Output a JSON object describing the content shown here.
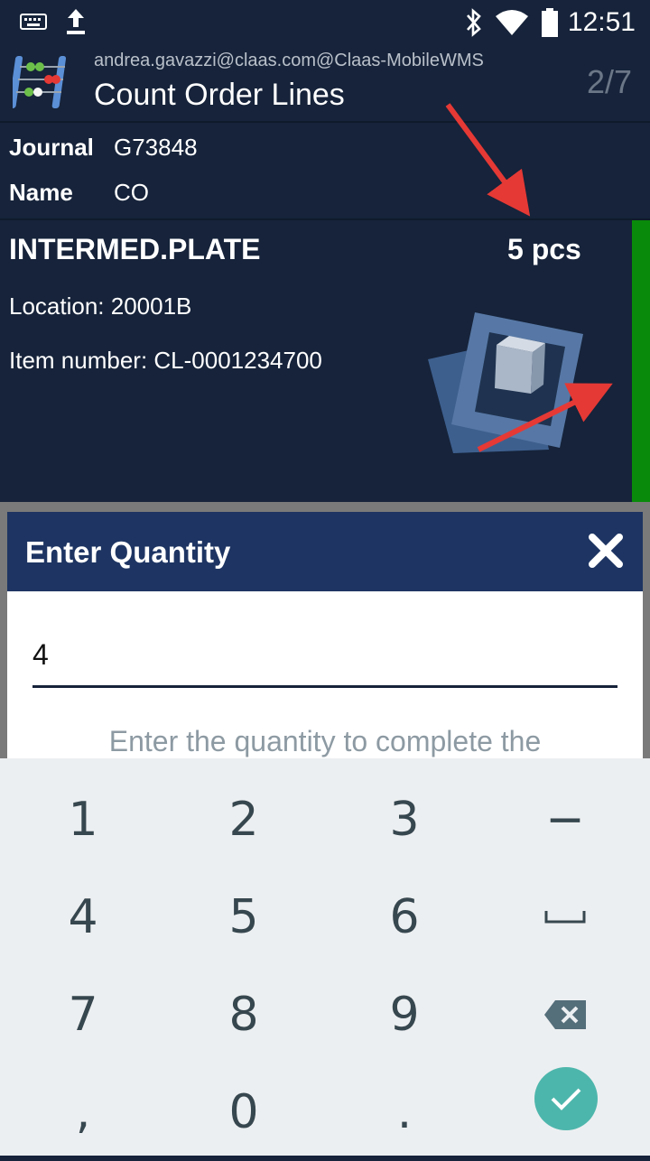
{
  "status_bar": {
    "time": "12:51",
    "icons": [
      "keyboard-icon",
      "upload-icon",
      "bluetooth-icon",
      "wifi-icon",
      "battery-icon"
    ]
  },
  "app_bar": {
    "user": "andrea.gavazzi@claas.com@Claas-MobileWMS",
    "title": "Count Order Lines",
    "pager": "2/7"
  },
  "journal": {
    "journal_label": "Journal",
    "journal_value": "G73848",
    "name_label": "Name",
    "name_value": "CO"
  },
  "item": {
    "name": "INTERMED.PLATE",
    "quantity": "5 pcs",
    "location": "Location: 20001B",
    "item_number": "Item number: CL-0001234700",
    "status_color": "#0a8a0a"
  },
  "dialog": {
    "title": "Enter Quantity",
    "input_value": "4",
    "hint": "Enter the quantity to complete the"
  },
  "keyboard": {
    "keys": [
      "1",
      "2",
      "3",
      "−",
      "4",
      "5",
      "6",
      "␣",
      "7",
      "8",
      "9",
      "⌫",
      ",",
      "0",
      ".",
      "✓"
    ],
    "accent": "#4db6ac"
  }
}
